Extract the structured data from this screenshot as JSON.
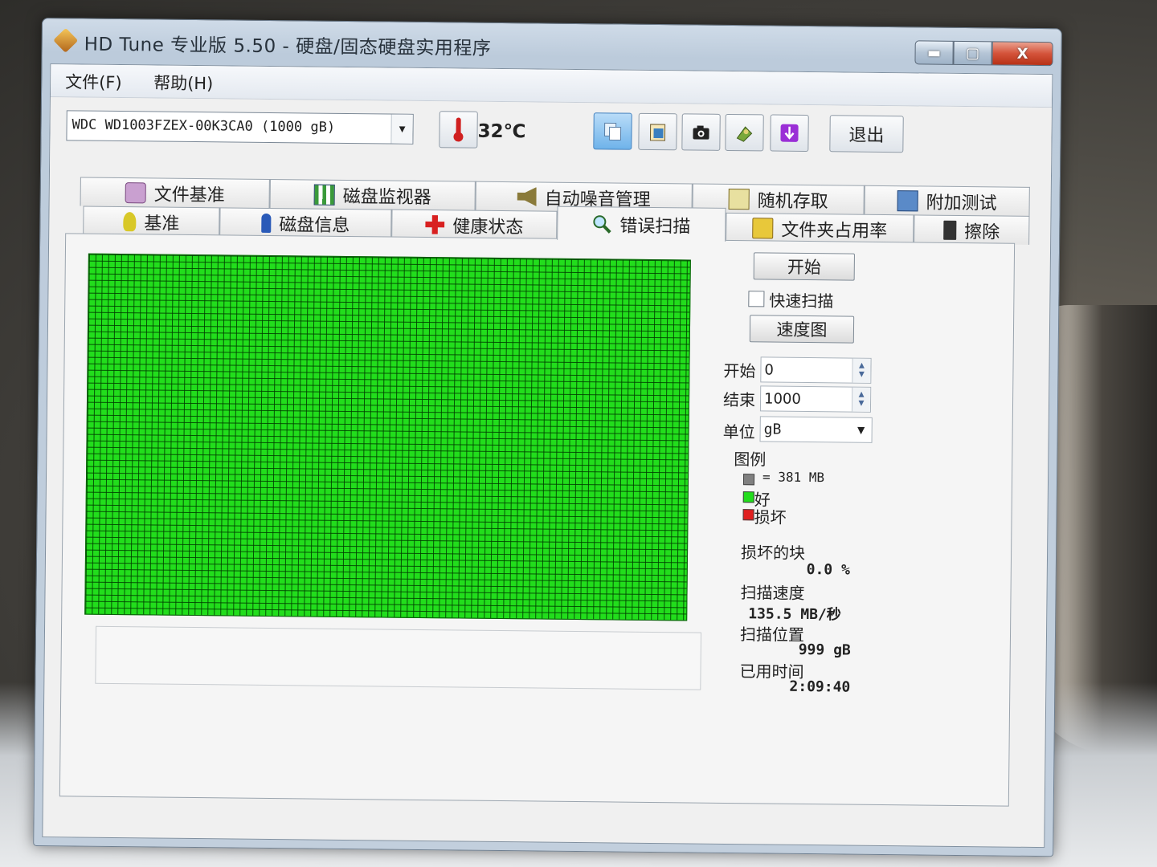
{
  "window": {
    "title": "HD Tune 专业版 5.50 - 硬盘/固态硬盘实用程序",
    "controls": {
      "minimize": "▬",
      "maximize": "▢",
      "close": "X"
    }
  },
  "menu": {
    "file": "文件(F)",
    "help": "帮助(H)"
  },
  "toolbar": {
    "drive": "WDC WD1003FZEX-00K3CA0 (1000 gB)",
    "temperature": "32℃",
    "exit": "退出",
    "icons": [
      "copy-icon",
      "screenshot-icon",
      "settings-icon",
      "download-icon"
    ]
  },
  "tabs": {
    "row1": [
      "文件基准",
      "磁盘监视器",
      "自动噪音管理",
      "随机存取",
      "附加测试"
    ],
    "row2": [
      "基准",
      "磁盘信息",
      "健康状态",
      "错误扫描",
      "文件夹占用率",
      "擦除"
    ],
    "selected": "错误扫描"
  },
  "scan": {
    "start_button": "开始",
    "quick_scan_label": "快速扫描",
    "quick_scan_checked": false,
    "speed_map_button": "速度图",
    "start_label": "开始",
    "start_value": "0",
    "end_label": "结束",
    "end_value": "1000",
    "unit_label": "单位",
    "unit_value": "gB",
    "legend_title": "图例",
    "legend_block": "= 381 MB",
    "legend_good": "好",
    "legend_bad": "损坏",
    "damaged_label": "损坏的块",
    "damaged_value": "0.0 %",
    "speed_label": "扫描速度",
    "speed_value": "135.5 MB/秒",
    "position_label": "扫描位置",
    "position_value": "999 gB",
    "elapsed_label": "已用时间",
    "elapsed_value": "2:09:40",
    "colors": {
      "good": "#22dd1c",
      "bad": "#e02020",
      "block": "#808080"
    }
  }
}
